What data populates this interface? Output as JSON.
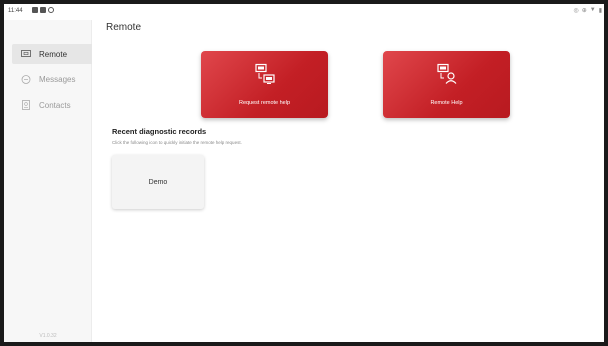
{
  "status_bar": {
    "time": "11:44"
  },
  "sidebar": {
    "items": [
      {
        "label": "Remote",
        "icon": "remote-icon",
        "active": true
      },
      {
        "label": "Messages",
        "icon": "message-icon",
        "active": false
      },
      {
        "label": "Contacts",
        "icon": "contacts-icon",
        "active": false
      }
    ],
    "version": "V1.0.32"
  },
  "main": {
    "title": "Remote",
    "actions": [
      {
        "label": "Request remote help",
        "icon": "screen-share-icon"
      },
      {
        "label": "Remote Help",
        "icon": "remote-assist-icon"
      }
    ],
    "recent": {
      "title": "Recent diagnostic records",
      "description": "Click the following icon to quickly initiate the remote help request.",
      "records": [
        {
          "label": "Demo"
        }
      ]
    }
  },
  "colors": {
    "accent": "#c8242a",
    "sidebar_bg": "#f7f7f7",
    "active_bg": "#e6e6e6"
  }
}
